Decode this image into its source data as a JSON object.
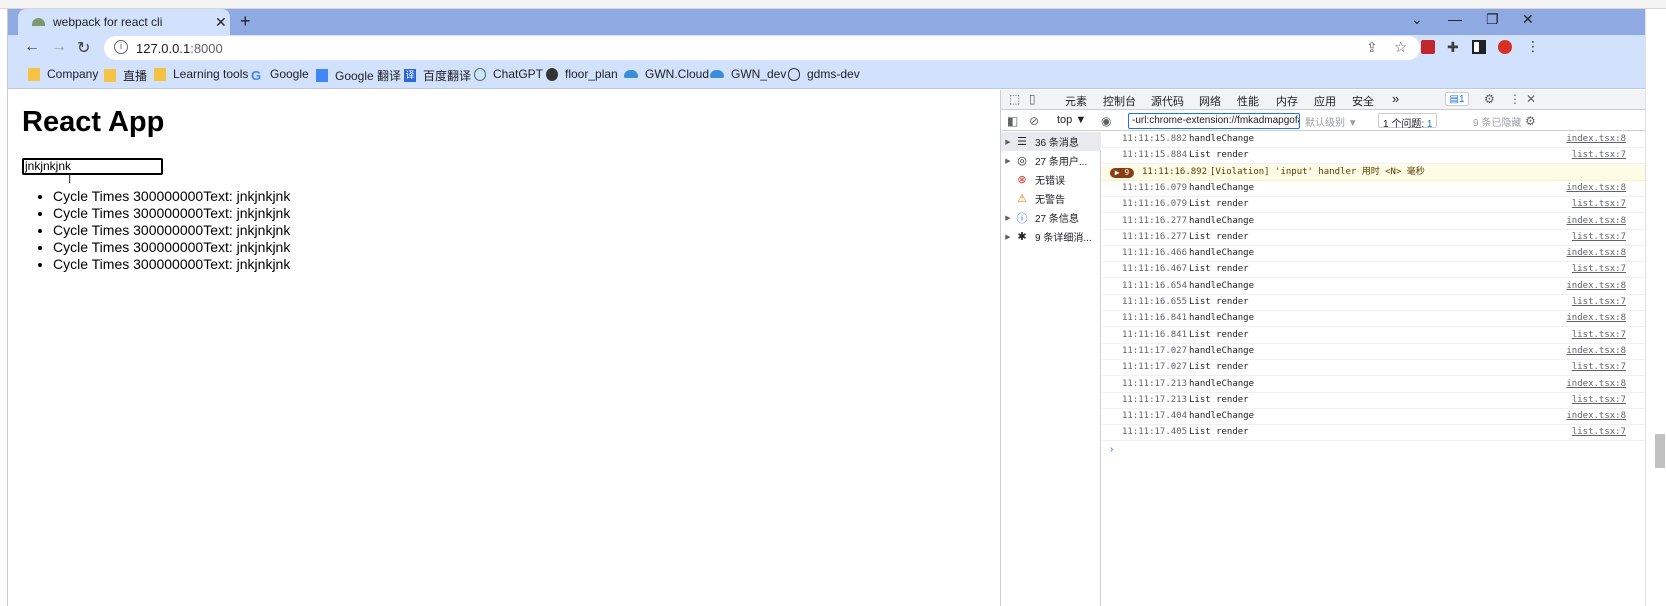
{
  "browser": {
    "tab_title": "webpack for react cli",
    "tab_close": "✕",
    "new_tab": "+",
    "window_controls": {
      "collapse": "⌄",
      "minimize": "—",
      "restore": "❐",
      "close": "✕"
    },
    "url_host": "127.0.0.1",
    "url_port": ":8000",
    "bookmarks": [
      {
        "label": "Company",
        "icon": "folder-icon"
      },
      {
        "label": "直播",
        "icon": "folder-icon"
      },
      {
        "label": "Learning tools",
        "icon": "folder-icon"
      },
      {
        "label": "Google",
        "icon": "google-icon"
      },
      {
        "label": "Google 翻译",
        "icon": "google-translate-icon"
      },
      {
        "label": "百度翻译",
        "icon": "baidu-translate-icon"
      },
      {
        "label": "ChatGPT",
        "icon": "chatgpt-icon"
      },
      {
        "label": "floor_plan",
        "icon": "globe-icon"
      },
      {
        "label": "GWN.Cloud",
        "icon": "cloud-icon"
      },
      {
        "label": "GWN_dev",
        "icon": "cloud-icon"
      },
      {
        "label": "gdms-dev",
        "icon": "link-icon"
      }
    ]
  },
  "page": {
    "heading": "React App",
    "input_value": "jnkjnkjnk",
    "list_items": [
      "Cycle Times 300000000Text: jnkjnkjnk",
      "Cycle Times 300000000Text: jnkjnkjnk",
      "Cycle Times 300000000Text: jnkjnkjnk",
      "Cycle Times 300000000Text: jnkjnkjnk",
      "Cycle Times 300000000Text: jnkjnkjnk"
    ]
  },
  "devtools": {
    "tabs": [
      "元素",
      "控制台",
      "源代码",
      "网络",
      "性能",
      "内存",
      "应用",
      "安全"
    ],
    "active_tab": "控制台",
    "more_tabs": "»",
    "issues_badge": "1",
    "context": "top ▼",
    "filter_value": "-url:chrome-extension://fmkadmapgofa",
    "default_levels": "默认级别 ▼",
    "issues_count": "1 个问题: ",
    "issues_count_badge": "1",
    "hidden_count": "9 条已隐藏",
    "sidebar": [
      {
        "label": "36 条消息",
        "icon": "list-icon",
        "expandable": true
      },
      {
        "label": "27 条用户...",
        "icon": "user-icon",
        "expandable": true
      },
      {
        "label": "无错误",
        "icon": "error-icon",
        "expandable": false
      },
      {
        "label": "无警告",
        "icon": "warning-icon",
        "expandable": false
      },
      {
        "label": "27 条信息",
        "icon": "info-icon",
        "expandable": true
      },
      {
        "label": "9 条详细消...",
        "icon": "bug-icon",
        "expandable": true
      }
    ],
    "logs": [
      {
        "ts": "11:11:15.882",
        "msg": "handleChange",
        "src": "index.tsx:8"
      },
      {
        "ts": "11:11:15.884",
        "msg": "List render",
        "src": "list.tsx:7"
      },
      {
        "ts": "11:11:16.892",
        "msg": "[Violation] 'input' handler 用时 <N> 毫秒",
        "src": "",
        "violation": true,
        "count": "9"
      },
      {
        "ts": "11:11:16.079",
        "msg": "handleChange",
        "src": "index.tsx:8"
      },
      {
        "ts": "11:11:16.079",
        "msg": "List render",
        "src": "list.tsx:7"
      },
      {
        "ts": "11:11:16.277",
        "msg": "handleChange",
        "src": "index.tsx:8"
      },
      {
        "ts": "11:11:16.277",
        "msg": "List render",
        "src": "list.tsx:7"
      },
      {
        "ts": "11:11:16.466",
        "msg": "handleChange",
        "src": "index.tsx:8"
      },
      {
        "ts": "11:11:16.467",
        "msg": "List render",
        "src": "list.tsx:7"
      },
      {
        "ts": "11:11:16.654",
        "msg": "handleChange",
        "src": "index.tsx:8"
      },
      {
        "ts": "11:11:16.655",
        "msg": "List render",
        "src": "list.tsx:7"
      },
      {
        "ts": "11:11:16.841",
        "msg": "handleChange",
        "src": "index.tsx:8"
      },
      {
        "ts": "11:11:16.841",
        "msg": "List render",
        "src": "list.tsx:7"
      },
      {
        "ts": "11:11:17.027",
        "msg": "handleChange",
        "src": "index.tsx:8"
      },
      {
        "ts": "11:11:17.027",
        "msg": "List render",
        "src": "list.tsx:7"
      },
      {
        "ts": "11:11:17.213",
        "msg": "handleChange",
        "src": "index.tsx:8"
      },
      {
        "ts": "11:11:17.213",
        "msg": "List render",
        "src": "list.tsx:7"
      },
      {
        "ts": "11:11:17.404",
        "msg": "handleChange",
        "src": "index.tsx:8"
      },
      {
        "ts": "11:11:17.405",
        "msg": "List render",
        "src": "list.tsx:7"
      }
    ],
    "prompt": "›"
  },
  "colors": {
    "tabbar": "#8fa9e3",
    "toolbar": "#d3e2fc",
    "devtools_accent": "#1a73e8",
    "violation_bg": "#fffbe5"
  }
}
